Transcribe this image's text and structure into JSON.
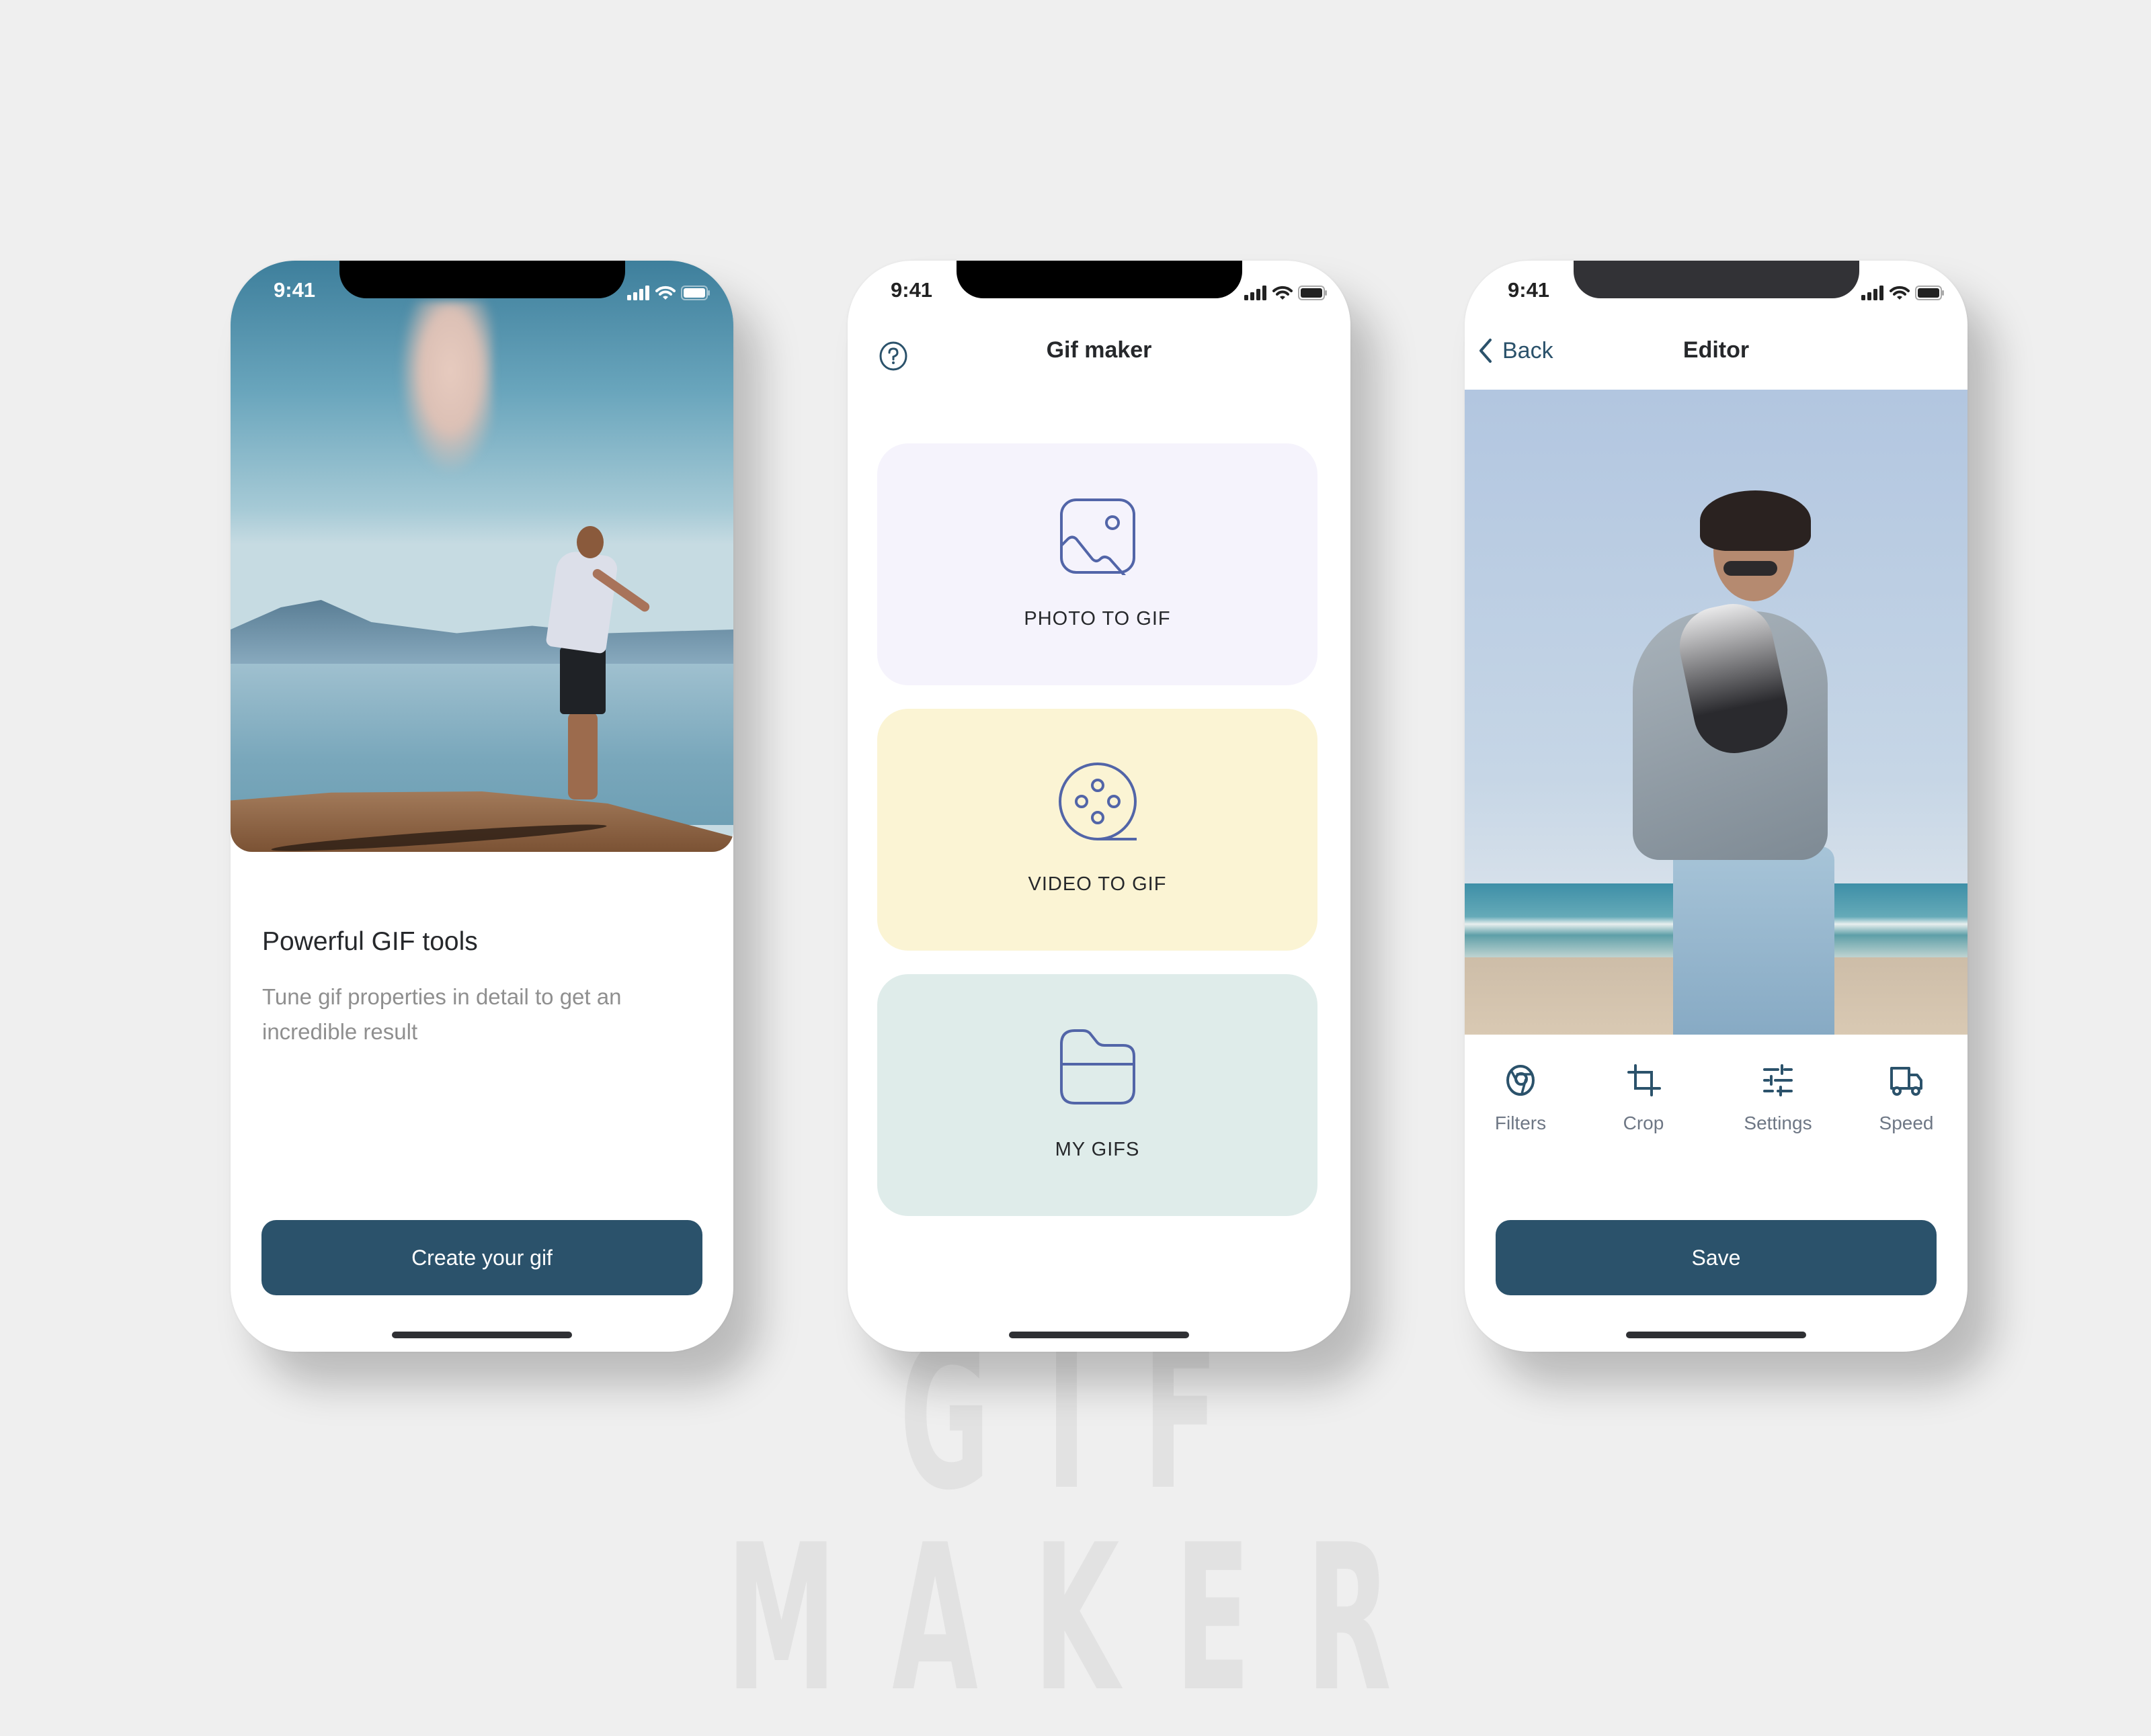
{
  "watermark": "GIF MAKER",
  "status_bar": {
    "time": "9:41"
  },
  "colors": {
    "primary": "#2b526b",
    "icon_stroke": "#5265a8",
    "card_photo": "#f5f3fc",
    "card_video": "#fbf4d4",
    "card_mygifs": "#dfecea",
    "background": "#efefef"
  },
  "onboarding": {
    "title": "Powerful GIF tools",
    "description": "Tune gif properties in detail to get an incredible result",
    "cta_label": "Create your gif"
  },
  "home": {
    "title": "Gif maker",
    "help_icon": "question-circle-icon",
    "cards": [
      {
        "label": "PHOTO TO GIF",
        "icon": "image-icon"
      },
      {
        "label": "VIDEO TO GIF",
        "icon": "film-reel-icon"
      },
      {
        "label": "MY GIFS",
        "icon": "folder-icon"
      }
    ]
  },
  "editor": {
    "title": "Editor",
    "back_label": "Back",
    "tools": [
      {
        "label": "Filters",
        "icon": "filters-icon"
      },
      {
        "label": "Crop",
        "icon": "crop-icon"
      },
      {
        "label": "Settings",
        "icon": "sliders-icon"
      },
      {
        "label": "Speed",
        "icon": "truck-icon"
      }
    ],
    "save_label": "Save"
  }
}
